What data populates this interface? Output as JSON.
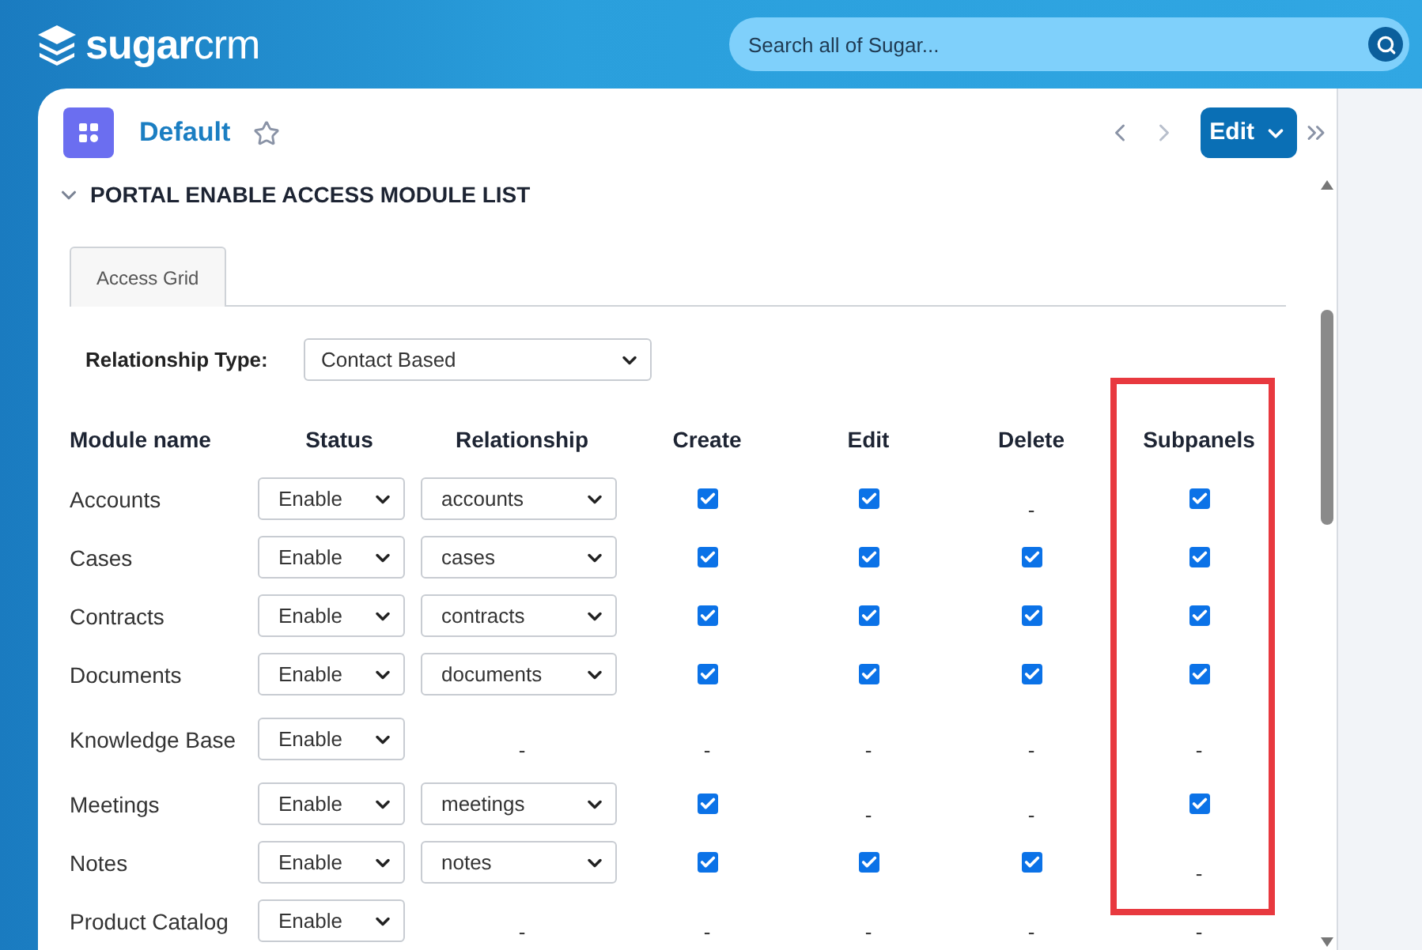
{
  "brand": {
    "name_bold": "sugar",
    "name_light": "crm"
  },
  "search": {
    "placeholder": "Search all of Sugar..."
  },
  "record": {
    "title": "Default",
    "favorite": false,
    "edit_button": "Edit"
  },
  "section": {
    "title": "PORTAL ENABLE ACCESS MODULE LIST",
    "expanded": true
  },
  "tabs": [
    {
      "label": "Access Grid",
      "selected": true
    }
  ],
  "relationship_type": {
    "label": "Relationship Type:",
    "value": "Contact Based"
  },
  "table": {
    "columns": [
      {
        "label": "Module name",
        "highlighted": false
      },
      {
        "label": "Status",
        "highlighted": false
      },
      {
        "label": "Relationship",
        "highlighted": false
      },
      {
        "label": "Create",
        "highlighted": false
      },
      {
        "label": "Edit",
        "highlighted": false
      },
      {
        "label": "Delete",
        "highlighted": false
      },
      {
        "label": "Subpanels",
        "highlighted": true
      }
    ],
    "rows": [
      {
        "cells": [
          {
            "kind": "text",
            "text": "Accounts"
          },
          {
            "kind": "select",
            "value": "Enable"
          },
          {
            "kind": "select",
            "value": "accounts"
          },
          {
            "kind": "checkbox",
            "checked": true
          },
          {
            "kind": "checkbox",
            "checked": true
          },
          {
            "kind": "dash",
            "text": "-"
          },
          {
            "kind": "checkbox",
            "checked": true
          }
        ]
      },
      {
        "cells": [
          {
            "kind": "text",
            "text": "Cases"
          },
          {
            "kind": "select",
            "value": "Enable"
          },
          {
            "kind": "select",
            "value": "cases"
          },
          {
            "kind": "checkbox",
            "checked": true
          },
          {
            "kind": "checkbox",
            "checked": true
          },
          {
            "kind": "checkbox",
            "checked": true
          },
          {
            "kind": "checkbox",
            "checked": true
          }
        ]
      },
      {
        "cells": [
          {
            "kind": "text",
            "text": "Contracts"
          },
          {
            "kind": "select",
            "value": "Enable"
          },
          {
            "kind": "select",
            "value": "contracts"
          },
          {
            "kind": "checkbox",
            "checked": true
          },
          {
            "kind": "checkbox",
            "checked": true
          },
          {
            "kind": "checkbox",
            "checked": true
          },
          {
            "kind": "checkbox",
            "checked": true
          }
        ]
      },
      {
        "cells": [
          {
            "kind": "text",
            "text": "Documents"
          },
          {
            "kind": "select",
            "value": "Enable"
          },
          {
            "kind": "select",
            "value": "documents"
          },
          {
            "kind": "checkbox",
            "checked": true
          },
          {
            "kind": "checkbox",
            "checked": true
          },
          {
            "kind": "checkbox",
            "checked": true
          },
          {
            "kind": "checkbox",
            "checked": true
          }
        ]
      },
      {
        "cells": [
          {
            "kind": "text",
            "text": "Knowledge Base"
          },
          {
            "kind": "select",
            "value": "Enable"
          },
          {
            "kind": "dash",
            "text": "-"
          },
          {
            "kind": "dash",
            "text": "-"
          },
          {
            "kind": "dash",
            "text": "-"
          },
          {
            "kind": "dash",
            "text": "-"
          },
          {
            "kind": "dash",
            "text": "-"
          }
        ]
      },
      {
        "cells": [
          {
            "kind": "text",
            "text": "Meetings"
          },
          {
            "kind": "select",
            "value": "Enable"
          },
          {
            "kind": "select",
            "value": "meetings"
          },
          {
            "kind": "checkbox",
            "checked": true
          },
          {
            "kind": "dash",
            "text": "-"
          },
          {
            "kind": "dash",
            "text": "-"
          },
          {
            "kind": "checkbox",
            "checked": true
          }
        ]
      },
      {
        "cells": [
          {
            "kind": "text",
            "text": "Notes"
          },
          {
            "kind": "select",
            "value": "Enable"
          },
          {
            "kind": "select",
            "value": "notes"
          },
          {
            "kind": "checkbox",
            "checked": true
          },
          {
            "kind": "checkbox",
            "checked": true
          },
          {
            "kind": "checkbox",
            "checked": true
          },
          {
            "kind": "dash",
            "text": "-"
          }
        ]
      },
      {
        "cells": [
          {
            "kind": "text",
            "text": "Product Catalog"
          },
          {
            "kind": "select",
            "value": "Enable"
          },
          {
            "kind": "dash",
            "text": "-"
          },
          {
            "kind": "dash",
            "text": "-"
          },
          {
            "kind": "dash",
            "text": "-"
          },
          {
            "kind": "dash",
            "text": "-"
          },
          {
            "kind": "dash",
            "text": "-"
          }
        ]
      }
    ]
  }
}
